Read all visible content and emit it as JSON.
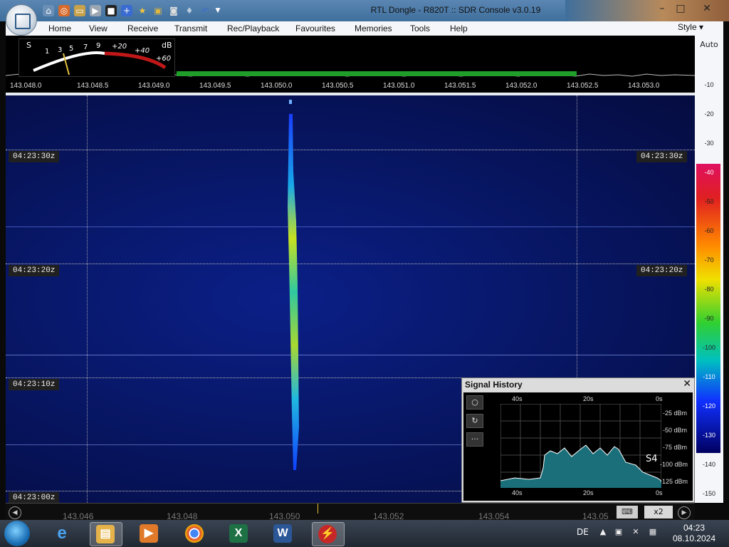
{
  "window": {
    "title": "RTL Dongle - R820T :: SDR Console v3.0.19",
    "minimize_icon": "minimize-icon",
    "maximize_icon": "maximize-icon",
    "close_icon": "close-icon"
  },
  "quick_access": [
    "home-icon",
    "lifebuoy-icon",
    "folder-icon",
    "play-icon",
    "stop-icon",
    "plus-icon",
    "star-icon",
    "lock-icon",
    "camera-icon",
    "drop-icon",
    "undo-icon",
    "dropdown-arrow-icon"
  ],
  "menu": {
    "items": [
      "Home",
      "View",
      "Receive",
      "Transmit",
      "Rec/Playback",
      "Favourites",
      "Memories",
      "Tools",
      "Help"
    ],
    "style_label": "Style"
  },
  "meter": {
    "s_label": "S",
    "db_label": "dB",
    "scale": [
      "1",
      "3",
      "5",
      "7",
      "9",
      "+20",
      "+40",
      "+60"
    ]
  },
  "frequency_scale": [
    "143.048.0",
    "143.048.5",
    "143.049.0",
    "143.049.5",
    "143.050.0",
    "143.050.5",
    "143.051.0",
    "143.051.5",
    "143.052.0",
    "143.052.5",
    "143.053.0"
  ],
  "waterfall": {
    "time_labels": [
      "04:23:30z",
      "04:23:20z",
      "04:23:10z",
      "04:23:00z"
    ]
  },
  "level_scale": {
    "auto_label": "Auto",
    "levels": [
      "-10",
      "-20",
      "-30",
      "-40",
      "-50",
      "-60",
      "-70",
      "-80",
      "-90",
      "-100",
      "-110",
      "-120",
      "-130",
      "-140",
      "-150"
    ]
  },
  "signal_history": {
    "title": "Signal History",
    "buttons": [
      "○",
      "↻",
      "···"
    ],
    "top_ticks": [
      "40s",
      "20s",
      "0s"
    ],
    "bottom_ticks": [
      "40s",
      "20s",
      "0s"
    ],
    "dbm_ticks": [
      "-25 dBm",
      "-50 dBm",
      "-75 dBm",
      "-100 dBm",
      "-125 dBm"
    ],
    "s_reading": "S4"
  },
  "bandbar": {
    "ticks": [
      "143.046",
      "143.048",
      "143.050",
      "143.052",
      "143.054",
      "143.05"
    ],
    "zoom_label": "x2"
  },
  "taskbar": {
    "apps": [
      {
        "name": "internet-explorer",
        "glyph": "e",
        "color": "#1e88e5"
      },
      {
        "name": "file-explorer",
        "glyph": "▤",
        "color": "#e6b34a"
      },
      {
        "name": "media-player",
        "glyph": "▶",
        "color": "#4a9ad8"
      },
      {
        "name": "chrome",
        "glyph": "●",
        "color": "#d93025"
      },
      {
        "name": "excel",
        "glyph": "X",
        "color": "#1d7145"
      },
      {
        "name": "word",
        "glyph": "W",
        "color": "#2b5797"
      },
      {
        "name": "sdr-console",
        "glyph": "⚡",
        "color": "#c62828"
      }
    ],
    "language": "DE",
    "time": "04:23",
    "date": "08.10.2024"
  }
}
